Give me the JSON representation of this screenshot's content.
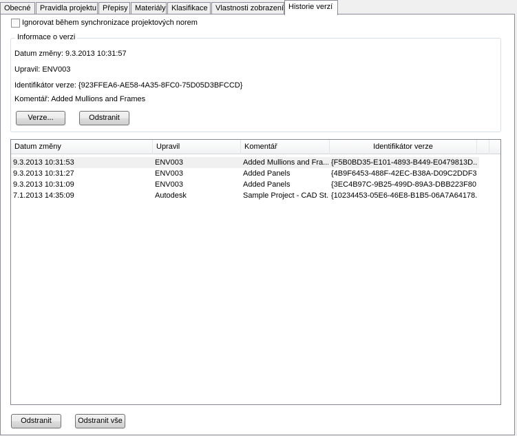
{
  "tabs": [
    {
      "label": "Obecné"
    },
    {
      "label": "Pravidla projektu"
    },
    {
      "label": "Přepisy"
    },
    {
      "label": "Materiály"
    },
    {
      "label": "Klasifikace"
    },
    {
      "label": "Vlastnosti zobrazení"
    },
    {
      "label": "Historie verzí"
    }
  ],
  "ignore_checkbox": {
    "label": "Ignorovat během synchronizace projektových norem",
    "checked": false
  },
  "version_info": {
    "title": "Informace o verzi",
    "date_line": "Datum změny: 9.3.2013 10:31:57",
    "author_line": "Upravil: ENV003",
    "id_line": "Identifikátor verze: {923FFEA6-AE58-4A35-8FC0-75D05D3BFCCD}",
    "comment_line": "Komentář: Added Mullions and Frames",
    "versions_button": "Verze...",
    "remove_button": "Odstranit"
  },
  "history_table": {
    "columns": [
      "Datum změny",
      "Upravil",
      "Komentář",
      "Identifikátor verze"
    ],
    "rows": [
      {
        "date": "9.3.2013 10:31:53",
        "author": "ENV003",
        "comment": "Added Mullions and Fra...",
        "id": "{F5B0BD35-E101-4893-B449-E0479813D...",
        "selected": true
      },
      {
        "date": "9.3.2013 10:31:27",
        "author": "ENV003",
        "comment": "Added Panels",
        "id": "{4B9F6453-488F-42EC-B38A-D09C2DDF3...",
        "selected": false
      },
      {
        "date": "9.3.2013 10:31:09",
        "author": "ENV003",
        "comment": "Added Panels",
        "id": "{3EC4B97C-9B25-499D-89A3-DBB223F80...",
        "selected": false
      },
      {
        "date": "7.1.2013 14:35:09",
        "author": "Autodesk",
        "comment": "Sample Project - CAD St...",
        "id": "{10234453-05E6-46E8-B1B5-06A7A64178...",
        "selected": false
      }
    ]
  },
  "bottom_buttons": {
    "remove": "Odstranit",
    "remove_all": "Odstranit vše"
  }
}
